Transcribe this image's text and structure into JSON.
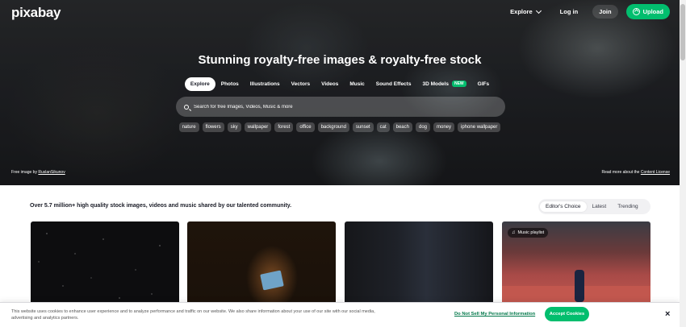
{
  "header": {
    "logo": "pixabay",
    "nav": {
      "explore": "Explore",
      "login": "Log in",
      "join": "Join",
      "upload": "Upload"
    }
  },
  "hero": {
    "headline": "Stunning royalty-free images & royalty-free stock",
    "tabs": [
      {
        "label": "Explore",
        "active": true
      },
      {
        "label": "Photos"
      },
      {
        "label": "Illustrations"
      },
      {
        "label": "Vectors"
      },
      {
        "label": "Videos"
      },
      {
        "label": "Music"
      },
      {
        "label": "Sound Effects"
      },
      {
        "label": "3D Models",
        "badge": "NEW"
      },
      {
        "label": "GIFs"
      }
    ],
    "search": {
      "placeholder": "Search for free Images, Videos, Music & more"
    },
    "chips": [
      "nature",
      "flowers",
      "sky",
      "wallpaper",
      "forest",
      "office",
      "background",
      "sunset",
      "cat",
      "beach",
      "dog",
      "money",
      "iphone wallpaper"
    ],
    "credit": {
      "prefix": "Free image by",
      "author": "RuslanSikunov"
    },
    "license": {
      "prefix": "Read more about the",
      "link": "Content License"
    }
  },
  "content": {
    "intro": "Over 5.7 million+ high quality stock images, videos and music shared by our talented community.",
    "sort": [
      "Editor's Choice",
      "Latest",
      "Trending"
    ],
    "thumbs": [
      {
        "badge": ""
      },
      {
        "badge": ""
      },
      {
        "badge": ""
      },
      {
        "badge": "Music playlist"
      }
    ]
  },
  "cookie": {
    "text": "This website uses cookies to enhance user experience and to analyze performance and traffic on our website. We also share information about your use of our site with our social media, advertising and analytics partners.",
    "link": "Do Not Sell My Personal Information",
    "accept": "Accept Cookies",
    "close": "×"
  },
  "colors": {
    "brand": "#02be6e"
  }
}
